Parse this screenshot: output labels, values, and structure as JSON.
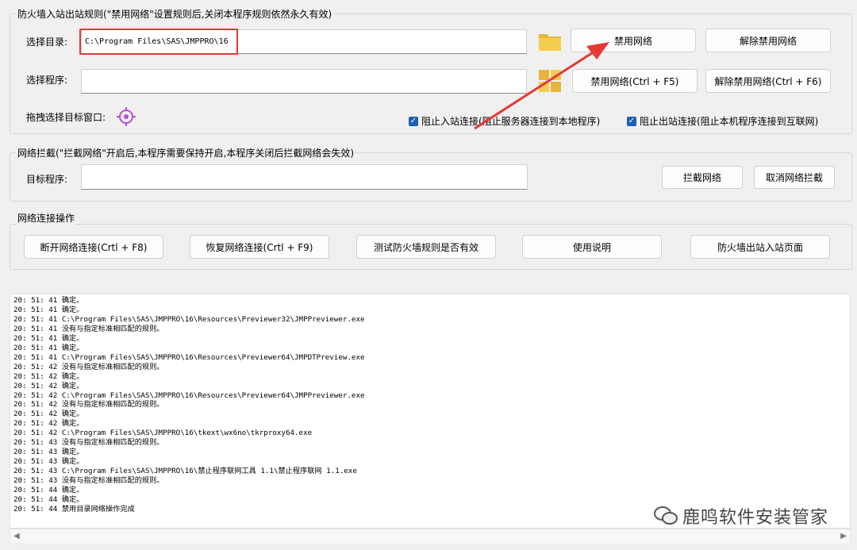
{
  "firewall_group": {
    "title": "防火墙入站出站规则(\"禁用网络\"设置规则后,关闭本程序规则依然永久有效)",
    "dir_label": "选择目录:",
    "dir_value": "C:\\Program Files\\SAS\\JMPPRO\\16",
    "prog_label": "选择程序:",
    "prog_value": "",
    "drag_label": "拖拽选择目标窗口:",
    "btn_disable": "禁用网络",
    "btn_enable": "解除禁用网络",
    "btn_disable_prog": "禁用网络(Ctrl + F5)",
    "btn_enable_prog": "解除禁用网络(Ctrl + F6)",
    "chk_inbound": "阻止入站连接(阻止服务器连接到本地程序)",
    "chk_outbound": "阻止出站连接(阻止本机程序连接到互联网)"
  },
  "intercept_group": {
    "title": "网络拦截(\"拦截网络\"开启后,本程序需要保持开启,本程序关闭后拦截网络会失效)",
    "target_label": "目标程序:",
    "target_value": "",
    "btn_intercept": "拦截网络",
    "btn_cancel": "取消网络拦截"
  },
  "conn_group": {
    "title": "网络连接操作",
    "btn_disconnect": "断开网络连接(Crtl + F8)",
    "btn_restore": "恢复网络连接(Crtl + F9)",
    "btn_test": "测试防火墙规则是否有效",
    "btn_help": "使用说明",
    "btn_page": "防火墙出站入站页面"
  },
  "log_lines": [
    "20: 51: 41 确定。",
    "20: 51: 41 确定。",
    "20: 51: 41 C:\\Program Files\\SAS\\JMPPRO\\16\\Resources\\Previewer32\\JMPPreviewer.exe",
    "20: 51: 41 没有与指定标准相匹配的规则。",
    "20: 51: 41 确定。",
    "20: 51: 41 确定。",
    "20: 51: 41 C:\\Program Files\\SAS\\JMPPRO\\16\\Resources\\Previewer64\\JMPDTPreview.exe",
    "20: 51: 42 没有与指定标准相匹配的规则。",
    "20: 51: 42 确定。",
    "20: 51: 42 确定。",
    "20: 51: 42 C:\\Program Files\\SAS\\JMPPRO\\16\\Resources\\Previewer64\\JMPPreviewer.exe",
    "20: 51: 42 没有与指定标准相匹配的规则。",
    "20: 51: 42 确定。",
    "20: 51: 42 确定。",
    "20: 51: 42 C:\\Program Files\\SAS\\JMPPRO\\16\\tkext\\wx6no\\tkrproxy64.exe",
    "20: 51: 43 没有与指定标准相匹配的规则。",
    "20: 51: 43 确定。",
    "20: 51: 43 确定。",
    "20: 51: 43 C:\\Program Files\\SAS\\JMPPRO\\16\\禁止程序联网工具 1.1\\禁止程序联网 1.1.exe",
    "20: 51: 43 没有与指定标准相匹配的规则。",
    "20: 51: 44 确定。",
    "20: 51: 44 确定。",
    "20: 51: 44 禁用目录网络操作完成"
  ],
  "brand": "鹿鸣软件安装管家",
  "colors": {
    "highlight": "#e53935",
    "arrow": "#e53935",
    "checkbox": "#1a5fb4",
    "target_icon": "#b44fd6"
  }
}
